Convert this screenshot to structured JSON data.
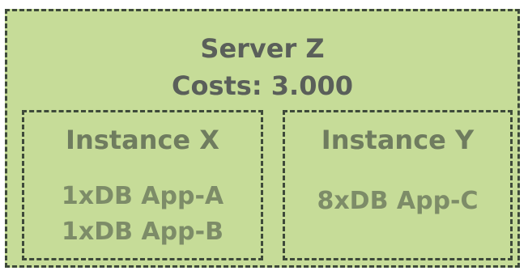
{
  "server": {
    "name": "Server Z",
    "costs": "Costs: 3.000"
  },
  "instances": [
    {
      "name": "Instance X",
      "apps": [
        "1xDB App-A",
        "1xDB App-B"
      ]
    },
    {
      "name": "Instance Y",
      "apps": [
        "8xDB App-C"
      ]
    }
  ],
  "colors": {
    "background": "#c6dc98",
    "border": "#3e4a3a",
    "server_text": "#5a5f5a",
    "instance_text": "#6f7c5f",
    "app_text": "#7d8c68"
  }
}
